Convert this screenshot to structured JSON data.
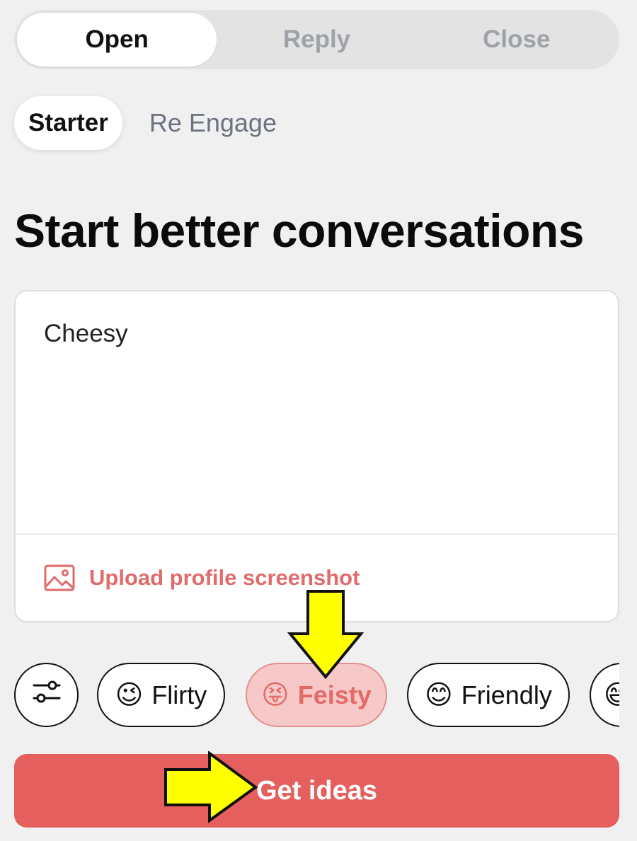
{
  "top_tabs": [
    "Open",
    "Reply",
    "Close"
  ],
  "sub_tabs": {
    "active": "Starter",
    "other": "Re Engage"
  },
  "heading": "Start better conversations",
  "input": {
    "value": "Cheesy"
  },
  "upload": {
    "label": "Upload profile screenshot",
    "icon": "image-icon"
  },
  "chips": {
    "filter_icon": "sliders-icon",
    "items": [
      {
        "emoji": "😉",
        "label": "Flirty"
      },
      {
        "emoji": "😝",
        "label": "Feisty",
        "selected": true
      },
      {
        "emoji": "😊",
        "label": "Friendly"
      },
      {
        "emoji": "😄",
        "label": ""
      }
    ]
  },
  "cta": {
    "label": "Get ideas"
  },
  "colors": {
    "accent": "#e45f5d",
    "selected_chip_bg": "#f6c9c8",
    "annotation": "#ffff00"
  }
}
